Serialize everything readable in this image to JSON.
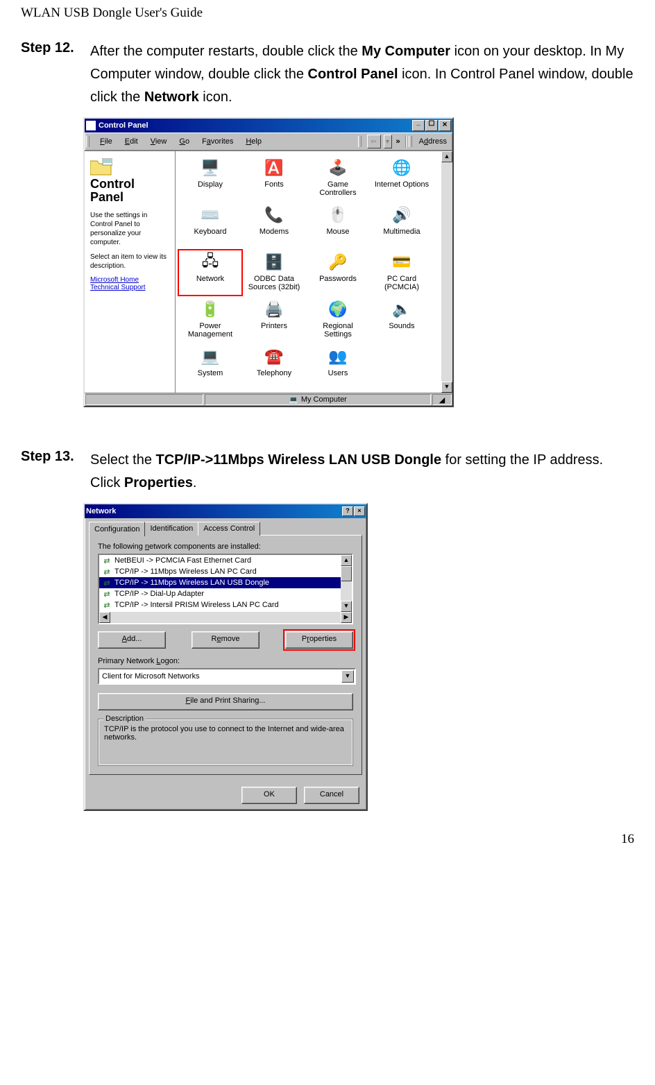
{
  "running_head": "WLAN USB Dongle User's Guide",
  "page_number": "16",
  "step12": {
    "label": "Step 12.",
    "pre1": "After the computer restarts, double click the ",
    "b1": "My Computer",
    "mid1": " icon on your desktop. In My Computer window, double click the ",
    "b2": "Control Panel",
    "mid2": " icon. In Control Panel window, double click the ",
    "b3": "Network",
    "post": " icon."
  },
  "cp_window": {
    "title": "Control Panel",
    "menus": {
      "file": "File",
      "edit": "Edit",
      "view": "View",
      "go": "Go",
      "favorites": "Favorites",
      "help": "Help"
    },
    "toolbar": {
      "chevron": "»",
      "address_label": "Address"
    },
    "left": {
      "title_line1": "Control",
      "title_line2": "Panel",
      "desc1": "Use the settings in Control Panel to personalize your computer.",
      "desc2": "Select an item to view its description.",
      "link1": "Microsoft Home",
      "link2": "Technical Support"
    },
    "icons": [
      {
        "label": "Display",
        "glyph": "🖥️"
      },
      {
        "label": "Fonts",
        "glyph": "🅰️"
      },
      {
        "label": "Game Controllers",
        "glyph": "🕹️"
      },
      {
        "label": "Internet Options",
        "glyph": "🌐"
      },
      {
        "label": "Keyboard",
        "glyph": "⌨️"
      },
      {
        "label": "Modems",
        "glyph": "📞"
      },
      {
        "label": "Mouse",
        "glyph": "🖱️"
      },
      {
        "label": "Multimedia",
        "glyph": "🔊"
      },
      {
        "label": "Network",
        "glyph": "🖧"
      },
      {
        "label": "ODBC Data Sources (32bit)",
        "glyph": "🗄️"
      },
      {
        "label": "Passwords",
        "glyph": "🔑"
      },
      {
        "label": "PC Card (PCMCIA)",
        "glyph": "💳"
      },
      {
        "label": "Power Management",
        "glyph": "🔋"
      },
      {
        "label": "Printers",
        "glyph": "🖨️"
      },
      {
        "label": "Regional Settings",
        "glyph": "🌍"
      },
      {
        "label": "Sounds",
        "glyph": "🔈"
      },
      {
        "label": "System",
        "glyph": "💻"
      },
      {
        "label": "Telephony",
        "glyph": "☎️"
      },
      {
        "label": "Users",
        "glyph": "👥"
      },
      {
        "label": "",
        "glyph": ""
      }
    ],
    "status": {
      "right_text": "My Computer",
      "right_icon": "💻"
    }
  },
  "step13": {
    "label": "Step 13.",
    "pre1": "Select the ",
    "b1": "TCP/IP->11Mbps Wireless LAN USB Dongle",
    "mid1": " for setting the IP address. Click ",
    "b2": "Properties",
    "post": "."
  },
  "net_dialog": {
    "title": "Network",
    "tabs": {
      "config": "Configuration",
      "ident": "Identification",
      "access": "Access Control"
    },
    "list_label_html": "The following network components are installed:",
    "list_items": [
      "NetBEUI -> PCMCIA Fast Ethernet Card",
      "TCP/IP -> 11Mbps Wireless LAN PC Card",
      "TCP/IP -> 11Mbps Wireless LAN USB Dongle",
      "TCP/IP -> Dial-Up Adapter",
      "TCP/IP -> Intersil PRISM Wireless LAN PC Card"
    ],
    "selected_index": 2,
    "buttons": {
      "add": "Add...",
      "remove": "Remove",
      "properties": "Properties"
    },
    "primary_logon_label": "Primary Network Logon:",
    "primary_logon_value": "Client for Microsoft Networks",
    "file_print": "File and Print Sharing...",
    "desc_legend": "Description",
    "desc_text": "TCP/IP is the protocol you use to connect to the Internet and wide-area networks.",
    "ok": "OK",
    "cancel": "Cancel"
  }
}
